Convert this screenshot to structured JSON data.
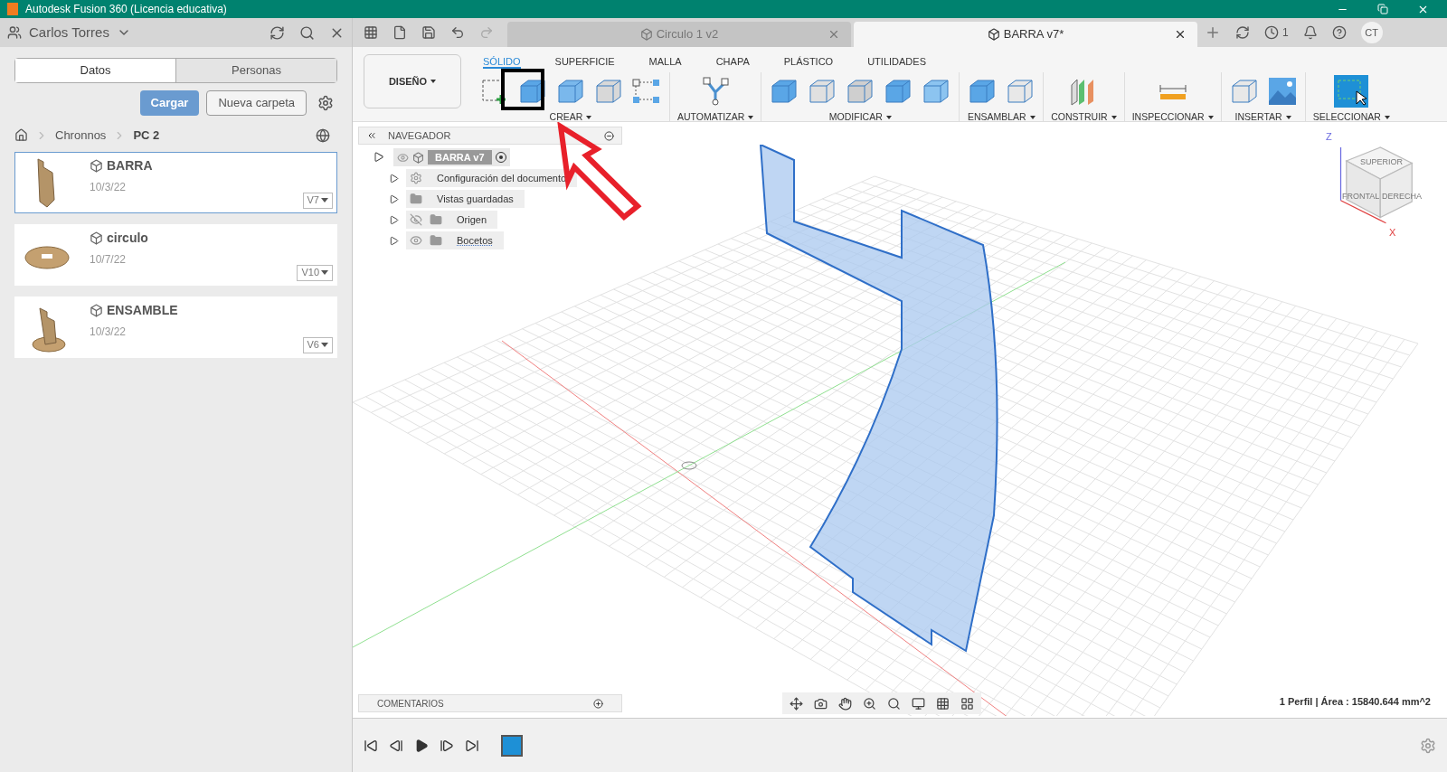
{
  "window": {
    "title": "Autodesk Fusion 360 (Licencia educativa)"
  },
  "data_panel": {
    "user": "Carlos Torres",
    "tabs": [
      {
        "label": "Datos",
        "selected": true
      },
      {
        "label": "Personas",
        "selected": false
      }
    ],
    "upload_button": "Cargar",
    "new_folder_button": "Nueva carpeta",
    "breadcrumb": [
      "Chronnos",
      "PC 2"
    ],
    "files": [
      {
        "name": "BARRA",
        "date": "10/3/22",
        "version": "V7",
        "selected": true,
        "kind": "bar"
      },
      {
        "name": "circulo",
        "date": "10/7/22",
        "version": "V10",
        "selected": false,
        "kind": "disc"
      },
      {
        "name": "ENSAMBLE",
        "date": "10/3/22",
        "version": "V6",
        "selected": false,
        "kind": "assembly"
      }
    ]
  },
  "document_tabs": [
    {
      "title": "Circulo 1 v2",
      "selected": false
    },
    {
      "title": "BARRA v7*",
      "selected": true
    }
  ],
  "jobs_count": "1",
  "user_initials": "CT",
  "workspace": "DISEÑO",
  "ribbon_tabs": [
    {
      "label": "SÓLIDO",
      "selected": true
    },
    {
      "label": "SUPERFICIE",
      "selected": false
    },
    {
      "label": "MALLA",
      "selected": false
    },
    {
      "label": "CHAPA",
      "selected": false
    },
    {
      "label": "PLÁSTICO",
      "selected": false
    },
    {
      "label": "UTILIDADES",
      "selected": false
    }
  ],
  "ribbon_groups": [
    "CREAR",
    "AUTOMATIZAR",
    "MODIFICAR",
    "ENSAMBLAR",
    "CONSTRUIR",
    "INSPECCIONAR",
    "INSERTAR",
    "SELECCIONAR"
  ],
  "browser": {
    "title": "NAVEGADOR",
    "root": {
      "label": "BARRA v7",
      "expanded": true
    },
    "items": [
      {
        "label": "Configuración del documento",
        "kind": "settings"
      },
      {
        "label": "Vistas guardadas",
        "kind": "folder"
      },
      {
        "label": "Origen",
        "kind": "hidden"
      },
      {
        "label": "Bocetos",
        "kind": "shown"
      }
    ]
  },
  "view_cube": {
    "faces": [
      "SUPERIOR",
      "FRONTAL",
      "DERECHA"
    ],
    "axes": [
      "Z",
      "X"
    ]
  },
  "comments": {
    "title": "COMENTARIOS"
  },
  "status": "1 Perfil | Área : 15840.644 mm^2"
}
